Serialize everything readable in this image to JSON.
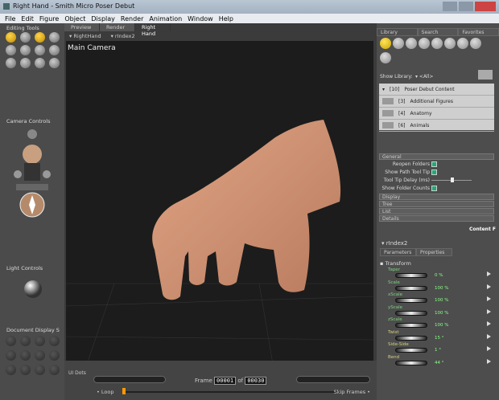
{
  "window": {
    "title": "Right Hand - Smith Micro Poser Debut"
  },
  "menu": [
    "File",
    "Edit",
    "Figure",
    "Object",
    "Display",
    "Render",
    "Animation",
    "Window",
    "Help"
  ],
  "left": {
    "editing_tools": "Editing Tools",
    "camera_controls": "Camera Controls",
    "light_controls": "Light Controls",
    "document_display": "Document Display S",
    "ui_dots": "UI Dots"
  },
  "viewport": {
    "tabs": [
      "Preview",
      "Render",
      "Right Hand"
    ],
    "figure": "RightHand",
    "actor": "rIndex2",
    "camera": "Main Camera"
  },
  "timeline": {
    "frame_label": "Frame",
    "current": "00001",
    "of_label": "of",
    "total": "00030",
    "loop": "Loop",
    "skip": "Skip Frames"
  },
  "library": {
    "tabs": [
      "Library",
      "Search",
      "Favorites"
    ],
    "show_library": "Show Library:",
    "library_value": "<All>",
    "tree": [
      {
        "count": "[10]",
        "name": "Poser Debut Content"
      },
      {
        "count": "[3]",
        "name": "Additional Figures"
      },
      {
        "count": "[4]",
        "name": "Anatomy"
      },
      {
        "count": "[6]",
        "name": "Animals"
      }
    ],
    "sections": [
      "General",
      "Display",
      "Tree",
      "List",
      "Details"
    ],
    "options": [
      {
        "label": "Reopen Folders",
        "checked": true
      },
      {
        "label": "Show Path Tool Tip",
        "checked": true
      },
      {
        "label": "Tool Tip Delay (ms)"
      },
      {
        "label": "Show Folder Counts",
        "checked": true
      }
    ],
    "content_label": "Content F"
  },
  "params": {
    "actor": "rIndex2",
    "tabs": [
      "Parameters",
      "Properties"
    ],
    "group": "Transform",
    "items": [
      {
        "name": "Taper",
        "value": "0 %"
      },
      {
        "name": "Scale",
        "value": "100 %"
      },
      {
        "name": "xScale",
        "value": "100 %"
      },
      {
        "name": "yScale",
        "value": "100 %"
      },
      {
        "name": "zScale",
        "value": "100 %"
      },
      {
        "name": "Twist",
        "value": "15 °"
      },
      {
        "name": "Side-Side",
        "value": "1 °"
      },
      {
        "name": "Bend",
        "value": "44 °"
      }
    ]
  },
  "colors": {
    "accent": "#f2c200",
    "skin": "#d99a7c"
  }
}
